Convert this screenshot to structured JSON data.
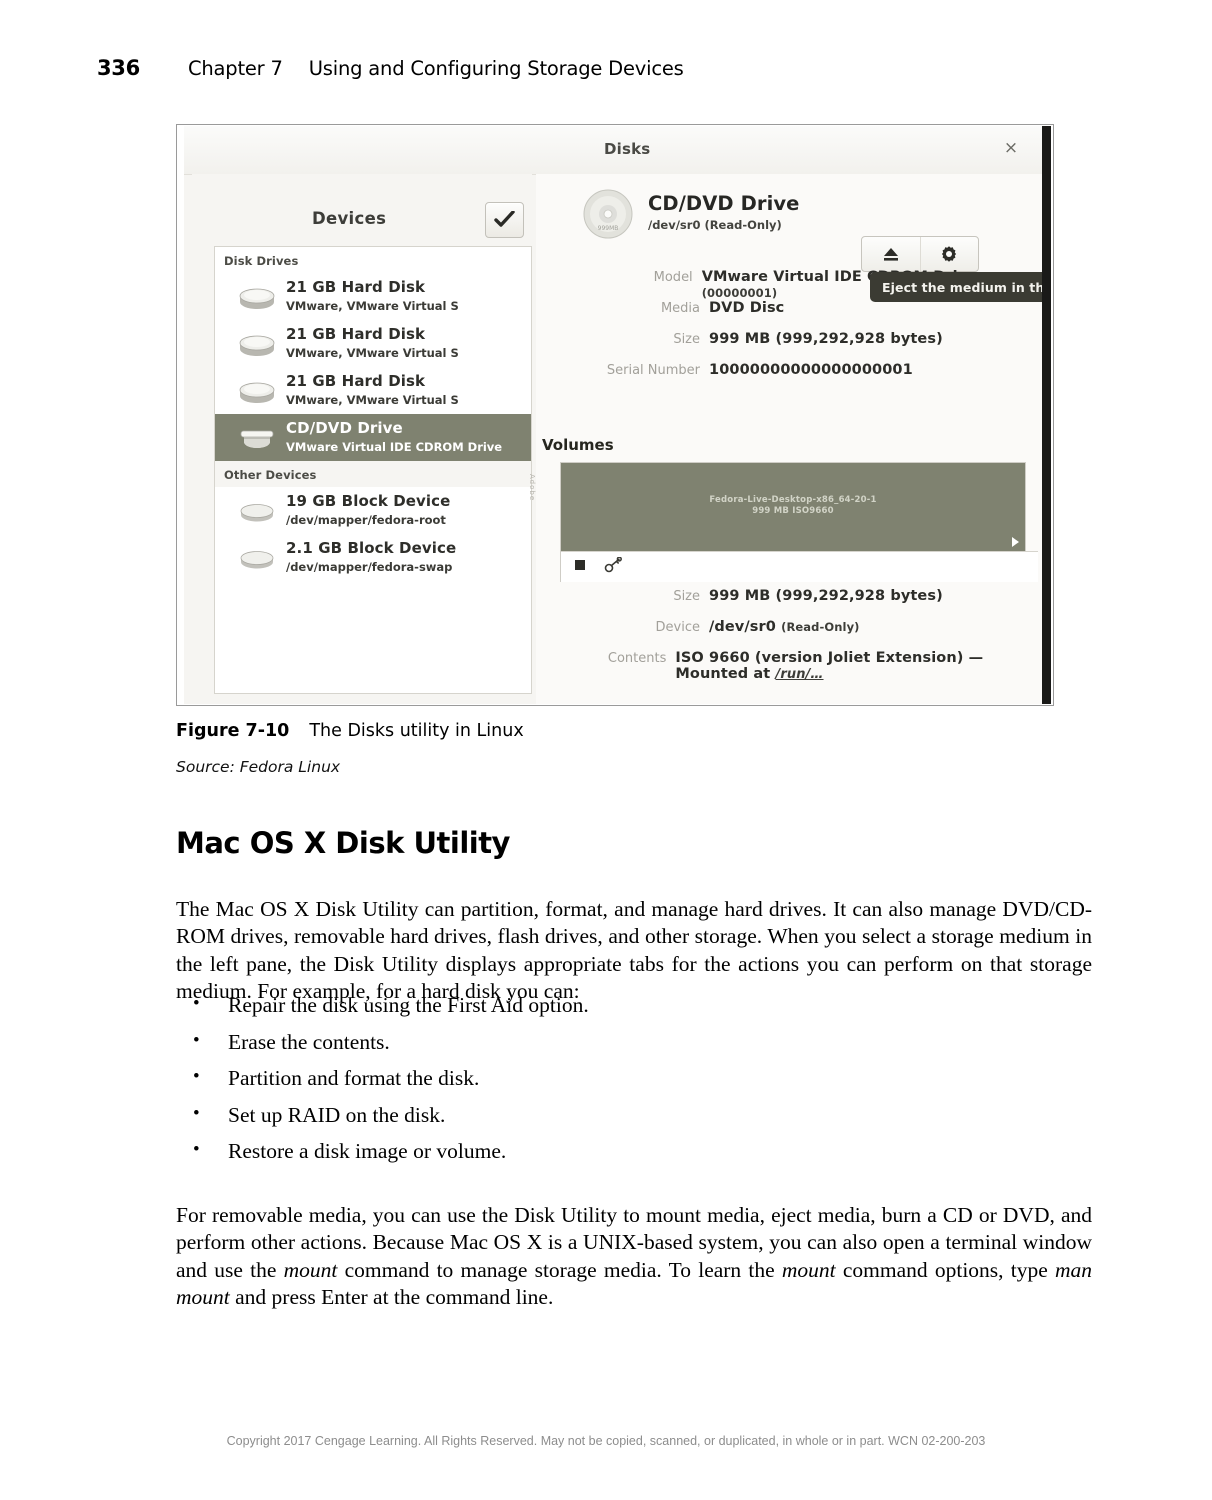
{
  "running_head": {
    "page_number": "336",
    "chapter": "Chapter 7",
    "chapter_title": "Using and Configuring Storage Devices"
  },
  "figure": {
    "caption_number": "Figure 7-10",
    "caption_text": "The Disks utility in Linux",
    "source": "Source: Fedora Linux",
    "window": {
      "title": "Disks",
      "close_label": "×",
      "left_pane": {
        "header": "Devices",
        "check_button_icon": "check-icon",
        "groups": [
          {
            "label": "Disk Drives",
            "items": [
              {
                "name": "21 GB Hard Disk",
                "detail": "VMware, VMware Virtual S",
                "icon": "hard-disk-icon",
                "selected": false
              },
              {
                "name": "21 GB Hard Disk",
                "detail": "VMware, VMware Virtual S",
                "icon": "hard-disk-icon",
                "selected": false
              },
              {
                "name": "21 GB Hard Disk",
                "detail": "VMware, VMware Virtual S",
                "icon": "hard-disk-icon",
                "selected": false
              },
              {
                "name": "CD/DVD Drive",
                "detail": "VMware Virtual IDE CDROM Drive",
                "icon": "optical-drive-icon",
                "selected": true
              }
            ]
          },
          {
            "label": "Other Devices",
            "items": [
              {
                "name": "19 GB Block Device",
                "detail": "/dev/mapper/fedora-root",
                "icon": "block-device-icon",
                "selected": false
              },
              {
                "name": "2.1 GB Block Device",
                "detail": "/dev/mapper/fedora-swap",
                "icon": "block-device-icon",
                "selected": false
              }
            ]
          }
        ]
      },
      "right_pane": {
        "drive_name": "CD/DVD Drive",
        "drive_device": "/dev/sr0 (Read-Only)",
        "drive_icon": "optical-disc-icon",
        "buttons": [
          {
            "name": "eject-button",
            "icon": "eject-icon"
          },
          {
            "name": "more-actions-button",
            "icon": "gear-icon"
          }
        ],
        "tooltip": "Eject the medium in the drive",
        "properties": [
          {
            "key": "Model",
            "value": "VMware Virtual IDE CDROM Drive",
            "value_dim": "(00000001)"
          },
          {
            "key": "Media",
            "value": "DVD Disc",
            "value_dim": ""
          },
          {
            "key": "Size",
            "value": "999 MB (999,292,928 bytes)",
            "value_dim": ""
          },
          {
            "key": "Serial Number",
            "value": "10000000000000000001",
            "value_dim": ""
          }
        ],
        "volumes_label": "Volumes",
        "volume": {
          "label_line_1": "Fedora-Live-Desktop-x86_64-20-1",
          "label_line_2": "999 MB ISO9660"
        },
        "volume_toolbar": [
          {
            "name": "unmount-button",
            "icon": "stop-square-icon"
          },
          {
            "name": "unlock-button",
            "icon": "key-icon"
          }
        ],
        "volume_properties": [
          {
            "key": "Size",
            "value": "999 MB (999,292,928 bytes)",
            "value_dim": ""
          },
          {
            "key": "Device",
            "value": "/dev/sr0",
            "value_dim": "(Read-Only)"
          },
          {
            "key": "Contents",
            "value": "ISO 9660 (version Joliet Extension) — Mounted at",
            "link": "/run/…"
          }
        ]
      }
    }
  },
  "section": {
    "heading": "Mac OS X Disk Utility",
    "paragraph_1": "The Mac OS X Disk Utility can partition, format, and manage hard drives. It can also manage DVD/CD-ROM drives, removable hard drives, flash drives, and other storage. When you select a storage medium in the left pane, the Disk Utility displays appropriate tabs for the actions you can perform on that storage medium. For example, for a hard disk you can:",
    "bullets": [
      "Repair the disk using the First Aid option.",
      "Erase the contents.",
      "Partition and format the disk.",
      "Set up RAID on the disk.",
      "Restore a disk image or volume."
    ],
    "paragraph_2_parts": [
      {
        "text": "For removable media, you can use the Disk Utility to mount media, eject media, burn a CD or DVD, and perform other actions. Because Mac OS X is a UNIX-based system, you can also open a terminal window and use the ",
        "italic": false
      },
      {
        "text": "mount",
        "italic": true
      },
      {
        "text": " command to manage storage media. To learn the ",
        "italic": false
      },
      {
        "text": "mount",
        "italic": true
      },
      {
        "text": " command options, type ",
        "italic": false
      },
      {
        "text": "man mount",
        "italic": true
      },
      {
        "text": " and press Enter at the command line.",
        "italic": false
      }
    ]
  },
  "footer": {
    "copyright": "Copyright 2017 Cengage Learning. All Rights Reserved. May not be copied, scanned, or duplicated, in whole or in part.  WCN 02-200-203"
  },
  "colors": {
    "selection": "#7f8270",
    "tooltip_bg": "#3b3b33",
    "window_bg": "#f6f5f2"
  }
}
